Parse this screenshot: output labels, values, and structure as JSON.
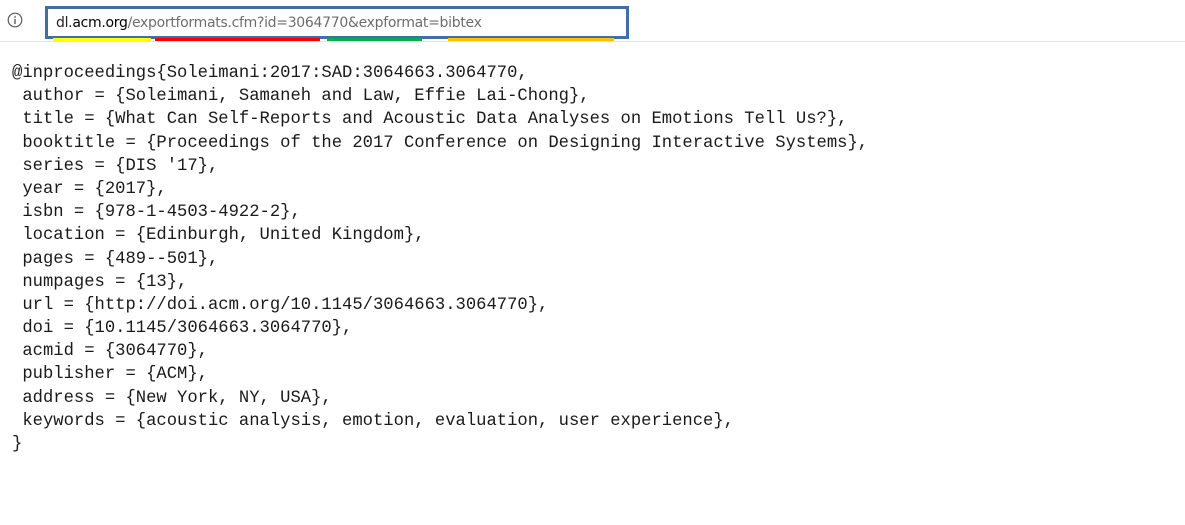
{
  "address_bar": {
    "info_icon": "info-circle-icon",
    "url": {
      "subdomain": "dl.",
      "host": "acm.org",
      "path": "/exportformats.cfm",
      "query_id": "?id=3064770",
      "query_format": "&expformat=bibtex"
    },
    "highlight_colors": {
      "domain": "#ffff00",
      "path": "#ff0000",
      "id": "#00b050",
      "format": "#ffc000",
      "box_border": "#3f6fa6"
    }
  },
  "bibtex": {
    "lines": [
      "@inproceedings{Soleimani:2017:SAD:3064663.3064770,",
      " author = {Soleimani, Samaneh and Law, Effie Lai-Chong},",
      " title = {What Can Self-Reports and Acoustic Data Analyses on Emotions Tell Us?},",
      " booktitle = {Proceedings of the 2017 Conference on Designing Interactive Systems},",
      " series = {DIS '17},",
      " year = {2017},",
      " isbn = {978-1-4503-4922-2},",
      " location = {Edinburgh, United Kingdom},",
      " pages = {489--501},",
      " numpages = {13},",
      " url = {http://doi.acm.org/10.1145/3064663.3064770},",
      " doi = {10.1145/3064663.3064770},",
      " acmid = {3064770},",
      " publisher = {ACM},",
      " address = {New York, NY, USA},",
      " keywords = {acoustic analysis, emotion, evaluation, user experience},",
      "}"
    ]
  }
}
